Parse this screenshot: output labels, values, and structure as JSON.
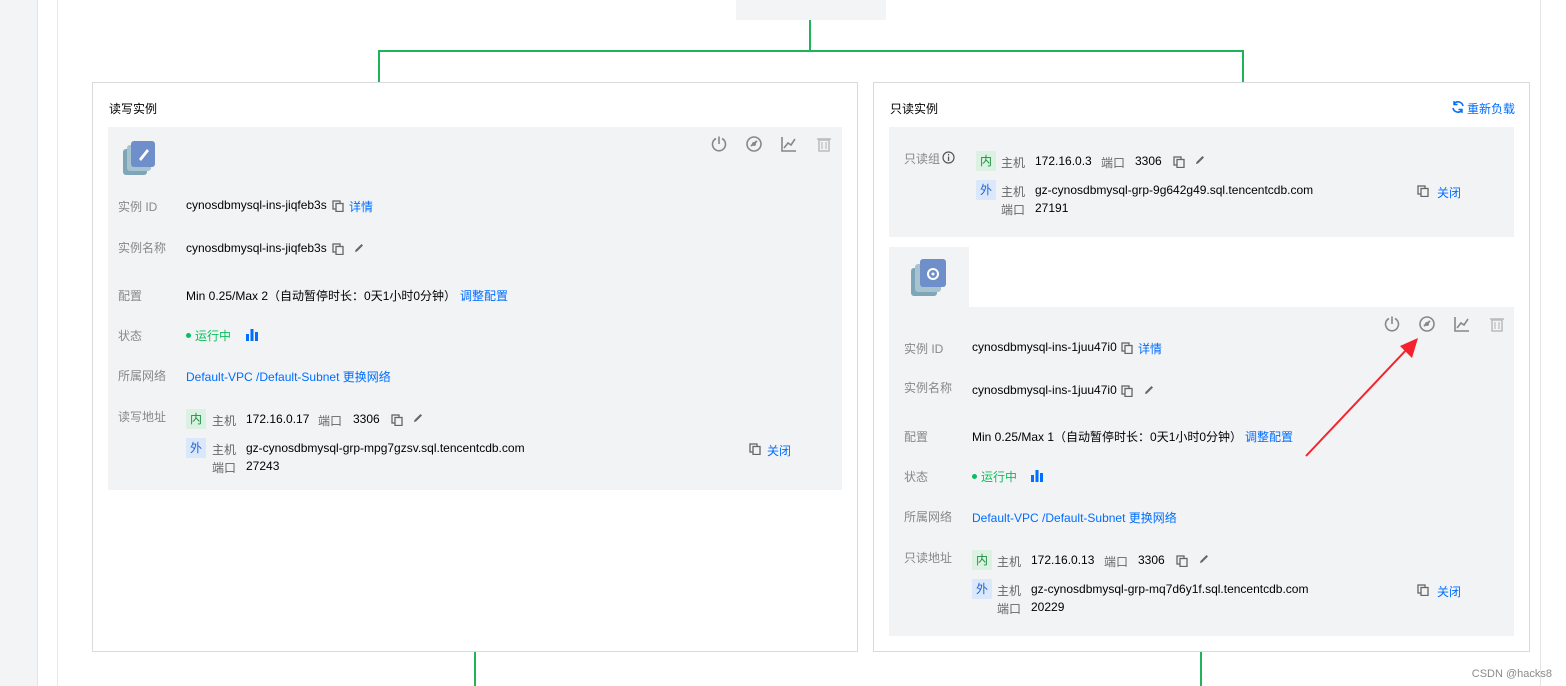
{
  "rw_panel": {
    "title": "读写实例",
    "instance_id_label": "实例 ID",
    "instance_id": "cynosdbmysql-ins-jiqfeb3s",
    "detail_link": "详情",
    "name_label": "实例名称",
    "name": "cynosdbmysql-ins-jiqfeb3s",
    "config_label": "配置",
    "config": "Min 0.25/Max 2（自动暂停时长：0天1小时0分钟）",
    "adjust_link": "调整配置",
    "status_label": "状态",
    "status": "运行中",
    "network_label": "所属网络",
    "vpc": "Default-VPC",
    "subnet": "/Default-Subnet",
    "change_network": "更换网络",
    "addr_label": "读写地址",
    "inner_tag": "内",
    "outer_tag": "外",
    "host_label": "主机",
    "port_label": "端口",
    "inner_host": "172.16.0.17",
    "inner_port": "3306",
    "outer_host": "gz-cynosdbmysql-grp-mpg7gzsv.sql.tencentcdb.com",
    "outer_port": "27243",
    "close_link": "关闭"
  },
  "ro_panel": {
    "title": "只读实例",
    "reload_link": "重新负载",
    "group_label": "只读组",
    "group_inner_tag": "内",
    "group_outer_tag": "外",
    "group_host_label": "主机",
    "group_port_label": "端口",
    "group_inner_host": "172.16.0.3",
    "group_inner_port": "3306",
    "group_outer_host": "gz-cynosdbmysql-grp-9g642g49.sql.tencentcdb.com",
    "group_outer_port": "27191",
    "group_close_link": "关闭",
    "instance_id_label": "实例 ID",
    "instance_id": "cynosdbmysql-ins-1juu47i0",
    "detail_link": "详情",
    "name_label": "实例名称",
    "name": "cynosdbmysql-ins-1juu47i0",
    "config_label": "配置",
    "config": "Min 0.25/Max 1（自动暂停时长：0天1小时0分钟）",
    "adjust_link": "调整配置",
    "status_label": "状态",
    "status": "运行中",
    "network_label": "所属网络",
    "vpc": "Default-VPC",
    "subnet": "/Default-Subnet",
    "change_network": "更换网络",
    "addr_label": "只读地址",
    "inner_tag": "内",
    "outer_tag": "外",
    "host_label": "主机",
    "port_label": "端口",
    "inner_host": "172.16.0.13",
    "inner_port": "3306",
    "outer_host": "gz-cynosdbmysql-grp-mq7d6y1f.sql.tencentcdb.com",
    "outer_port": "20229",
    "close_link": "关闭"
  },
  "colors": {
    "connector": "#20b35a",
    "link": "#006eff",
    "status_green": "#0abf5b",
    "annotation_arrow": "#f5222d"
  },
  "icons": [
    "power-icon",
    "restart-icon",
    "monitor-chart-icon",
    "delete-icon",
    "copy-icon",
    "edit-icon",
    "bar-chart-icon",
    "info-icon",
    "refresh-icon",
    "database-icon"
  ],
  "watermark": "CSDN @hacks8"
}
